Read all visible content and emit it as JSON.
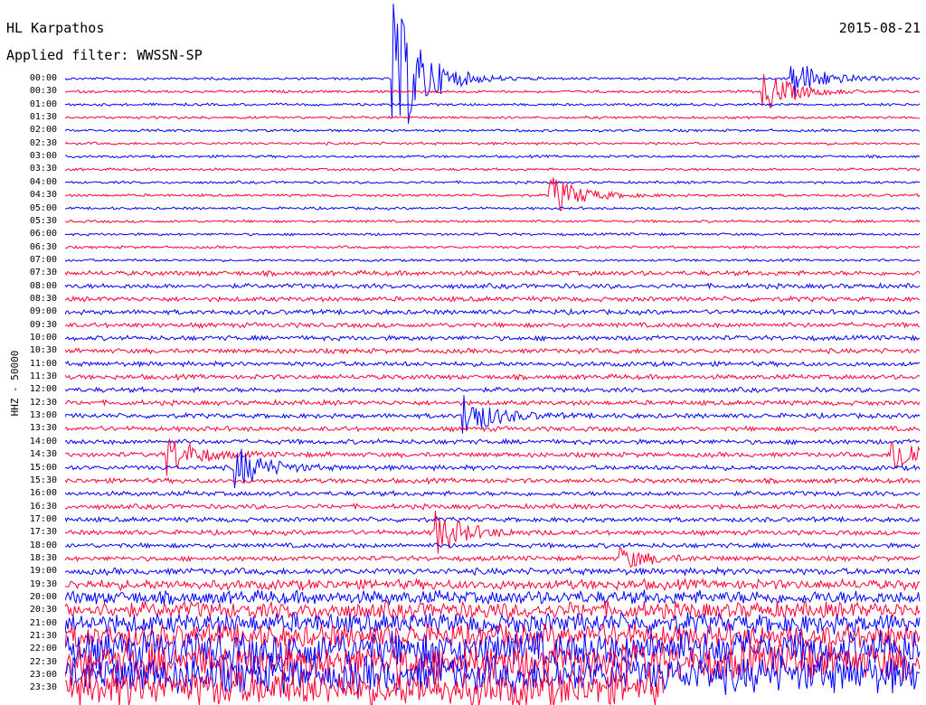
{
  "header": {
    "station": "HL Karpathos",
    "date": "2015-08-21",
    "filter_label": "Applied filter: WWSSN-SP"
  },
  "chart_data": {
    "type": "line",
    "title": "HL Karpathos",
    "subtitle": "Applied filter: WWSSN-SP",
    "ylabel": "HHZ - 50000",
    "rows": [
      "00:00",
      "00:30",
      "01:00",
      "01:30",
      "02:00",
      "02:30",
      "03:00",
      "03:30",
      "04:00",
      "04:30",
      "05:00",
      "05:30",
      "06:00",
      "06:30",
      "07:00",
      "07:30",
      "08:00",
      "08:30",
      "09:00",
      "09:30",
      "10:00",
      "10:30",
      "11:00",
      "11:30",
      "12:00",
      "12:30",
      "13:00",
      "13:30",
      "14:00",
      "14:30",
      "15:00",
      "15:30",
      "16:00",
      "16:30",
      "17:00",
      "17:30",
      "18:00",
      "18:30",
      "19:00",
      "19:30",
      "20:00",
      "20:30",
      "21:00",
      "21:30",
      "22:00",
      "22:30",
      "23:00",
      "23:30"
    ],
    "trace_colors": [
      "#0000ff",
      "#ff0033"
    ],
    "events": [
      {
        "row": "00:00",
        "minute": 11.5,
        "strength": "large"
      },
      {
        "row": "00:00",
        "minute": 25.5,
        "strength": "medium"
      },
      {
        "row": "00:30",
        "minute": 24.5,
        "strength": "medium"
      },
      {
        "row": "04:30",
        "minute": 17.0,
        "strength": "medium"
      },
      {
        "row": "13:00",
        "minute": 14.0,
        "strength": "medium"
      },
      {
        "row": "14:30",
        "minute": 3.5,
        "strength": "medium"
      },
      {
        "row": "14:30",
        "minute": 29.0,
        "strength": "medium"
      },
      {
        "row": "15:00",
        "minute": 6.0,
        "strength": "medium"
      },
      {
        "row": "17:30",
        "minute": 13.0,
        "strength": "medium"
      },
      {
        "row": "18:30",
        "minute": 19.5,
        "strength": "small"
      }
    ],
    "data_end_row": "23:30",
    "data_end_minute": 21
  }
}
